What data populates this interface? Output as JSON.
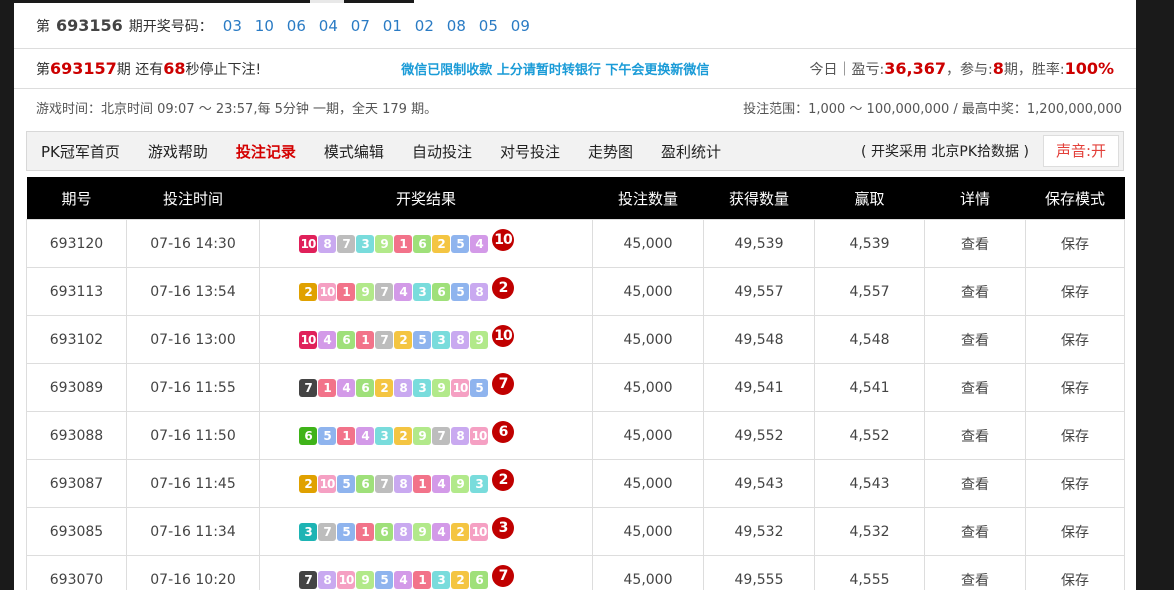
{
  "current": {
    "prefix": "第",
    "period": "693156",
    "suffix": "期开奖号码：",
    "numbers": [
      "03",
      "10",
      "06",
      "04",
      "07",
      "01",
      "02",
      "08",
      "05",
      "09"
    ]
  },
  "info": {
    "p1": "第",
    "next_period": "693157",
    "p2": "期 还有",
    "seconds": "68",
    "p3": "秒停止下注!",
    "notice": "微信已限制收款 上分请暂时转银行 下午会更换新微信",
    "r1": "今日｜盈亏:",
    "profit": "36,367",
    "r2": "，参与:",
    "joined": "8",
    "r3": "期，胜率:",
    "winrate": "100%"
  },
  "schedule": {
    "game_time": "游戏时间：北京时间 09:07 ～ 23:57,每 5分钟 一期，全天 179 期。",
    "bet_range": "投注范围：1,000 ～ 100,000,000 / 最高中奖：1,200,000,000"
  },
  "nav": {
    "items": [
      "PK冠军首页",
      "游戏帮助",
      "投注记录",
      "模式编辑",
      "自动投注",
      "对号投注",
      "走势图",
      "盈利统计"
    ],
    "source": "( 开奖采用 北京PK拾数据 )",
    "sound": "声音:开"
  },
  "table": {
    "headers": [
      "期号",
      "投注时间",
      "开奖结果",
      "投注数量",
      "获得数量",
      "赢取",
      "详情",
      "保存模式"
    ],
    "view_label": "查看",
    "save_label": "保存",
    "rows": [
      {
        "period": "693120",
        "time": "07-16 14:30",
        "balls": [
          10,
          8,
          7,
          3,
          9,
          1,
          6,
          2,
          5,
          4
        ],
        "badge": "10",
        "qty": "45,000",
        "get": "49,539",
        "win": "4,539"
      },
      {
        "period": "693113",
        "time": "07-16 13:54",
        "balls": [
          2,
          10,
          1,
          9,
          7,
          4,
          3,
          6,
          5,
          8
        ],
        "badge": "2",
        "qty": "45,000",
        "get": "49,557",
        "win": "4,557"
      },
      {
        "period": "693102",
        "time": "07-16 13:00",
        "balls": [
          10,
          4,
          6,
          1,
          7,
          2,
          5,
          3,
          8,
          9
        ],
        "badge": "10",
        "qty": "45,000",
        "get": "49,548",
        "win": "4,548"
      },
      {
        "period": "693089",
        "time": "07-16 11:55",
        "balls": [
          7,
          1,
          4,
          6,
          2,
          8,
          3,
          9,
          10,
          5
        ],
        "badge": "7",
        "qty": "45,000",
        "get": "49,541",
        "win": "4,541"
      },
      {
        "period": "693088",
        "time": "07-16 11:50",
        "balls": [
          6,
          5,
          1,
          4,
          3,
          2,
          9,
          7,
          8,
          10
        ],
        "badge": "6",
        "qty": "45,000",
        "get": "49,552",
        "win": "4,552"
      },
      {
        "period": "693087",
        "time": "07-16 11:45",
        "balls": [
          2,
          10,
          5,
          6,
          7,
          8,
          1,
          4,
          9,
          3
        ],
        "badge": "2",
        "qty": "45,000",
        "get": "49,543",
        "win": "4,543"
      },
      {
        "period": "693085",
        "time": "07-16 11:34",
        "balls": [
          3,
          7,
          5,
          1,
          6,
          8,
          9,
          4,
          2,
          10
        ],
        "badge": "3",
        "qty": "45,000",
        "get": "49,532",
        "win": "4,532"
      },
      {
        "period": "693070",
        "time": "07-16 10:20",
        "balls": [
          7,
          8,
          10,
          9,
          5,
          4,
          1,
          3,
          2,
          6
        ],
        "badge": "7",
        "qty": "45,000",
        "get": "49,555",
        "win": "4,555"
      }
    ]
  }
}
